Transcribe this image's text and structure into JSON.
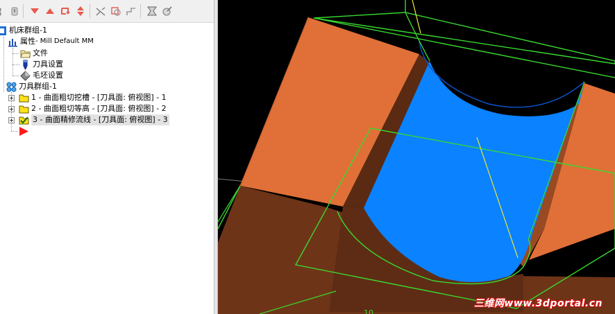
{
  "toolbar": {
    "icons": [
      "tool-icon",
      "filter-icon",
      "move-down-icon",
      "move-up-icon",
      "insert-arrow-icon",
      "expand-collapse-icon",
      "toggle-display-icon",
      "regenerate-icon",
      "post-icon",
      "highlight-icon",
      "verify-icon"
    ]
  },
  "tree": {
    "root": {
      "label": "机床群组-1"
    },
    "properties": {
      "label": "属性",
      "suffix": " - Mill Default MM"
    },
    "files": {
      "label": "文件"
    },
    "tool_settings": {
      "label": "刀具设置"
    },
    "stock_settings": {
      "label": "毛坯设置"
    },
    "toolpath_group": {
      "label": "刀具群组-1"
    },
    "operations": [
      {
        "label": "1 - 曲面粗切挖槽 - [刀具面: 俯视图] - 1"
      },
      {
        "label": "2 - 曲面粗切等高 - [刀具面: 俯视图] - 2"
      },
      {
        "label": "3 - 曲面精修流线 - [刀具面: 俯视图] - 3"
      }
    ]
  },
  "viewport": {
    "colors": {
      "background": "#000000",
      "stock_top": "#e07038",
      "stock_side": "#6e3418",
      "surface": "#0b82ff",
      "wireframe": "#39d92f",
      "toolpath": "#e8e840"
    },
    "watermark": "三维网www.3dportal.cn"
  }
}
